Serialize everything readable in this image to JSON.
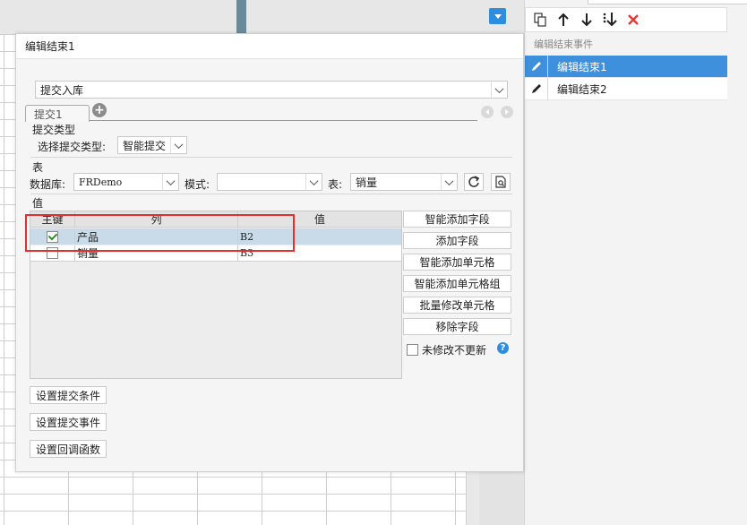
{
  "dialog": {
    "title": "编辑结束1",
    "submit_type_combo": "提交入库",
    "tabs": [
      {
        "label": "提交1"
      }
    ],
    "submit_section": {
      "title": "提交类型",
      "select_label": "选择提交类型:",
      "select_value": "智能提交"
    },
    "table_section": {
      "title": "表",
      "database_label": "数据库:",
      "database_value": "FRDemo",
      "mode_label": "模式:",
      "mode_value": "",
      "table_label": "表:",
      "table_value": "销量"
    },
    "value_section": {
      "title": "值",
      "columns": [
        "主键",
        "列",
        "值"
      ],
      "rows": [
        {
          "key": true,
          "column": "产品",
          "value": "B2"
        },
        {
          "key": false,
          "column": "销量",
          "value": "B3"
        }
      ]
    },
    "side_buttons": [
      "智能添加字段",
      "添加字段",
      "智能添加单元格",
      "智能添加单元格组",
      "批量修改单元格",
      "移除字段"
    ],
    "no_update_label": "未修改不更新",
    "help_label": "?",
    "bottom_buttons": [
      "设置提交条件",
      "设置提交事件",
      "设置回调函数"
    ]
  },
  "right_panel": {
    "caption": "编辑结束事件",
    "items": [
      {
        "label": "编辑结束1",
        "selected": true
      },
      {
        "label": "编辑结束2",
        "selected": false
      }
    ]
  },
  "colors": {
    "accent": "#3e8fdc",
    "highlight_border": "#e03030",
    "delete_red": "#e53935",
    "selected_row": "#c9dbe9"
  }
}
